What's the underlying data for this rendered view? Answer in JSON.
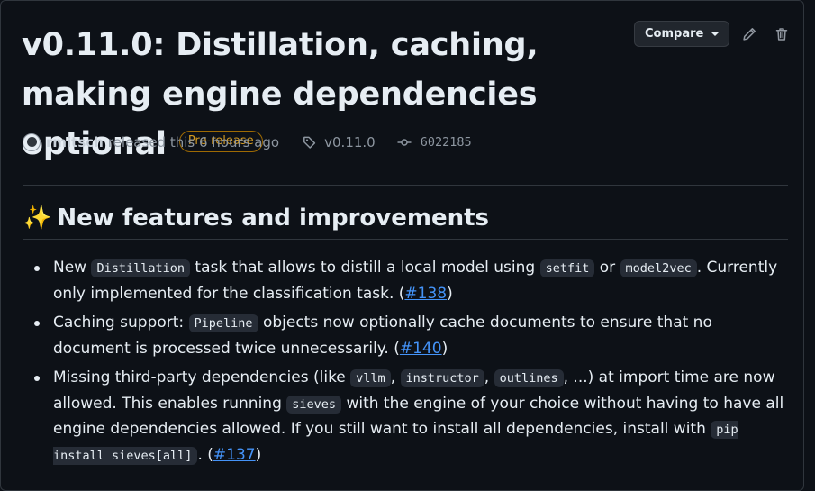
{
  "release": {
    "title": "v0.11.0: Distillation, caching, making engine dependencies optional",
    "badge": "Pre-release",
    "compare_label": "Compare",
    "author": "rmitsch",
    "released_text": "released this 6 hours ago",
    "tag": "v0.11.0",
    "commit": "6022185"
  },
  "notes": {
    "heading_emoji": "✨",
    "heading": "New features and improvements",
    "items": [
      {
        "t1": "New ",
        "c1": "Distillation",
        "t2": " task that allows to distill a local model using ",
        "c2": "setfit",
        "t3": " or ",
        "c3": "model2vec",
        "t4": ". Currently only implemented for the classification task. (",
        "link": "#138",
        "t5": ")"
      },
      {
        "t1": "Caching support: ",
        "c1": "Pipeline",
        "t2": " objects now optionally cache documents to ensure that no document is processed twice unnecessarily. (",
        "link": "#140",
        "t3": ")"
      },
      {
        "t1": "Missing third-party dependencies (like ",
        "c1": "vllm",
        "t2": ", ",
        "c2": "instructor",
        "t3": ", ",
        "c3": "outlines",
        "t4": ", ...) at import time are now allowed. This enables running ",
        "c4": "sieves",
        "t5": " with the engine of your choice without having to have all engine dependencies allowed. If you still want to install all dependencies, install with ",
        "c5": "pip install sieves[all]",
        "t6": ". (",
        "link": "#137",
        "t7": ")"
      }
    ]
  },
  "colors": {
    "background": "#0d1117",
    "badge": "#d29922",
    "link": "#4493f8"
  }
}
